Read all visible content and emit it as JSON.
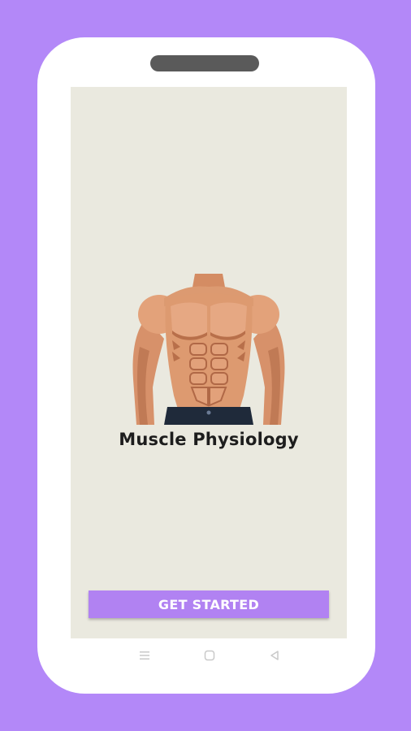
{
  "colors": {
    "background": "#b388f8",
    "screen": "#eae9df",
    "accent": "#b182f2"
  },
  "splash": {
    "hero_image": "muscular-torso-illustration",
    "title": "Muscle Physiology",
    "cta_label": "GET STARTED"
  },
  "system_nav": {
    "icons": [
      "menu-icon",
      "home-icon",
      "back-icon"
    ]
  }
}
